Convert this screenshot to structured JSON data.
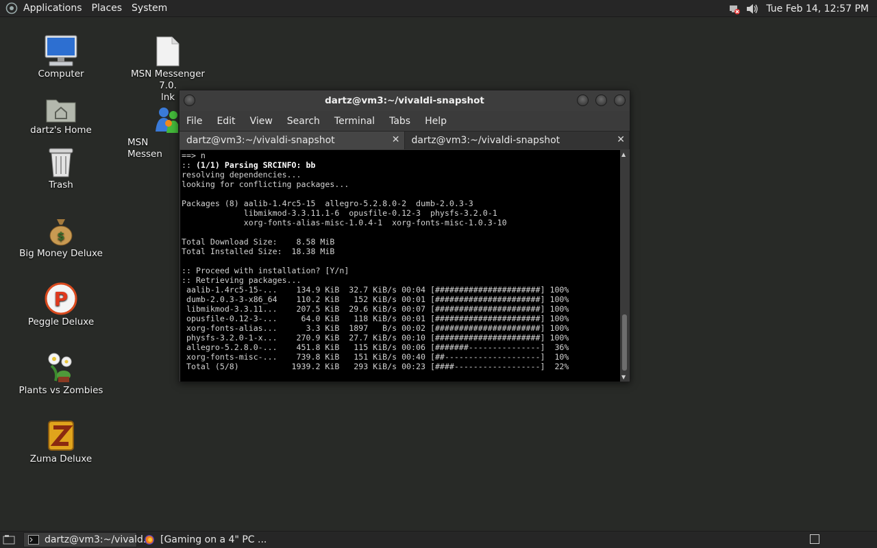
{
  "top_panel": {
    "menus": [
      "Applications",
      "Places",
      "System"
    ],
    "clock": "Tue Feb 14, 12:57 PM",
    "tray_icons": [
      "network-disconnected-icon",
      "volume-icon"
    ]
  },
  "desktop": {
    "icons": [
      {
        "label": "Computer",
        "icon": "computer-icon"
      },
      {
        "label": "dartz's Home",
        "icon": "home-folder-icon"
      },
      {
        "label": "Trash",
        "icon": "trash-icon"
      },
      {
        "label": "Big Money Deluxe",
        "icon": "money-bag-icon"
      },
      {
        "label": "Peggle Deluxe",
        "icon": "peggle-icon"
      },
      {
        "label": "Plants vs Zombies",
        "icon": "plants-vs-zombies-icon"
      },
      {
        "label": "Zuma Deluxe",
        "icon": "zuma-icon"
      },
      {
        "label": "MSN Messenger 7.0.\nlnk",
        "icon": "file-icon"
      },
      {
        "label": "MSN Messen",
        "icon": "msn-icon"
      }
    ]
  },
  "terminal": {
    "title": "dartz@vm3:~/vivaldi-snapshot",
    "menus": [
      "File",
      "Edit",
      "View",
      "Search",
      "Terminal",
      "Tabs",
      "Help"
    ],
    "tabs": [
      {
        "label": "dartz@vm3:~/vivaldi-snapshot"
      },
      {
        "label": "dartz@vm3:~/vivaldi-snapshot"
      }
    ],
    "lines": [
      "==> n",
      ":: (1/1) Parsing SRCINFO: bb",
      "resolving dependencies...",
      "looking for conflicting packages...",
      "",
      "Packages (8) aalib-1.4rc5-15  allegro-5.2.8.0-2  dumb-2.0.3-3",
      "             libmikmod-3.3.11.1-6  opusfile-0.12-3  physfs-3.2.0-1",
      "             xorg-fonts-alias-misc-1.0.4-1  xorg-fonts-misc-1.0.3-10",
      "",
      "Total Download Size:    8.58 MiB",
      "Total Installed Size:  18.38 MiB",
      "",
      ":: Proceed with installation? [Y/n]",
      ":: Retrieving packages...",
      " aalib-1.4rc5-15-...    134.9 KiB  32.7 KiB/s 00:04 [######################] 100%",
      " dumb-2.0.3-3-x86_64    110.2 KiB   152 KiB/s 00:01 [######################] 100%",
      " libmikmod-3.3.11...    207.5 KiB  29.6 KiB/s 00:07 [######################] 100%",
      " opusfile-0.12-3-...     64.0 KiB   118 KiB/s 00:01 [######################] 100%",
      " xorg-fonts-alias...      3.3 KiB  1897   B/s 00:02 [######################] 100%",
      " physfs-3.2.0-1-x...    270.9 KiB  27.7 KiB/s 00:10 [######################] 100%",
      " allegro-5.2.8.0-...    451.8 KiB   115 KiB/s 00:06 [#######---------------]  36%",
      " xorg-fonts-misc-...    739.8 KiB   151 KiB/s 00:40 [##--------------------]  10%",
      " Total (5/8)           1939.2 KiB   293 KiB/s 00:23 [####------------------]  22%"
    ]
  },
  "taskbar": {
    "tasks": [
      {
        "label": "dartz@vm3:~/vivald...",
        "icon": "terminal-icon"
      },
      {
        "label": "[Gaming on a 4\" PC ...",
        "icon": "firefox-icon"
      }
    ]
  }
}
